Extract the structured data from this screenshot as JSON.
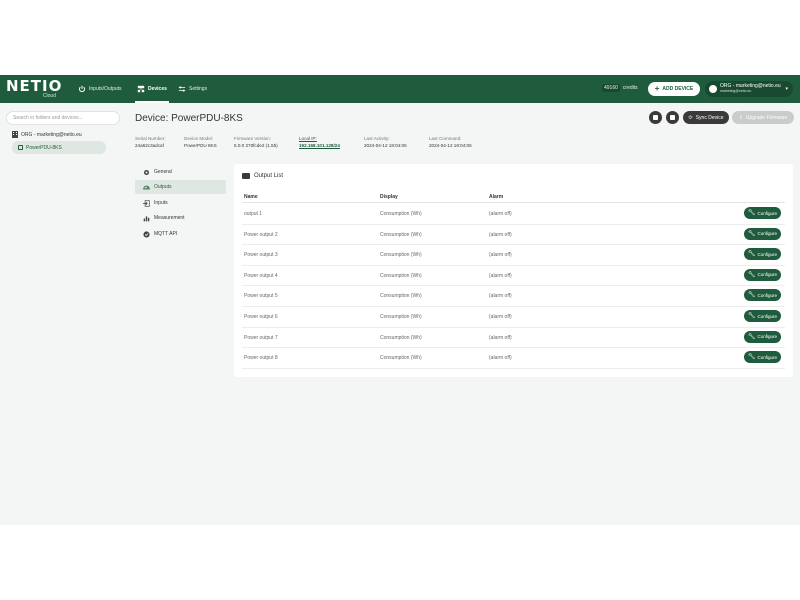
{
  "brand": {
    "logo": "NETIO",
    "sub": "Cloud"
  },
  "nav": {
    "inputs_outputs": "Inputs/Outputs",
    "devices": "Devices",
    "settings": "Settings"
  },
  "header": {
    "credits_value": "49160",
    "credits_label": "credits",
    "add_device": "ADD DEVICE",
    "account_org": "ORG - marketing@netio.eu",
    "account_email": "marketing@netio.eu"
  },
  "sidebar": {
    "search_placeholder": "Search in folders and devices...",
    "org": "ORG - marketing@netio.eu",
    "device": "PowerPDU-8KS"
  },
  "device": {
    "title": "Device: PowerPDU-8KS",
    "sync_label": "Sync Device",
    "upgrade_label": "Upgrade Firmware",
    "info": {
      "serial_label": "Serial Number:",
      "serial": "24a62c3adcaf",
      "model_label": "Device Model:",
      "model": "PowerPDU 8KS",
      "firmware_label": "Firmware Version:",
      "firmware": "5.0.0 270fcde2 (1.55)",
      "ip_label": "Local IP:",
      "ip": "192.168.101.128/24",
      "activity_label": "Last Activity:",
      "activity": "2024-04-12 18:04:06",
      "command_label": "Last Command:",
      "command": "2024-04-12 18:04:06"
    }
  },
  "subnav": [
    "General",
    "Outputs",
    "Inputs",
    "Measurement",
    "MQTT API"
  ],
  "output_list": {
    "title": "Output List",
    "columns": [
      "Name",
      "Display",
      "Alarm"
    ],
    "configure_label": "Configure",
    "rows": [
      {
        "name": "output 1",
        "display": "Consumption (Wh)",
        "alarm": "(alarm off)"
      },
      {
        "name": "Power output 2",
        "display": "Consumption (Wh)",
        "alarm": "(alarm off)"
      },
      {
        "name": "Power output 3",
        "display": "Consumption (Wh)",
        "alarm": "(alarm off)"
      },
      {
        "name": "Power output 4",
        "display": "Consumption (Wh)",
        "alarm": "(alarm off)"
      },
      {
        "name": "Power output 5",
        "display": "Consumption (Wh)",
        "alarm": "(alarm off)"
      },
      {
        "name": "Power output 6",
        "display": "Consumption (Wh)",
        "alarm": "(alarm off)"
      },
      {
        "name": "Power output 7",
        "display": "Consumption (Wh)",
        "alarm": "(alarm off)"
      },
      {
        "name": "Power output 8",
        "display": "Consumption (Wh)",
        "alarm": "(alarm off)"
      }
    ]
  },
  "colors": {
    "brand_green": "#1e5c3d",
    "active_bg": "#dfe7e2",
    "dark_button": "#3a3a3a"
  }
}
